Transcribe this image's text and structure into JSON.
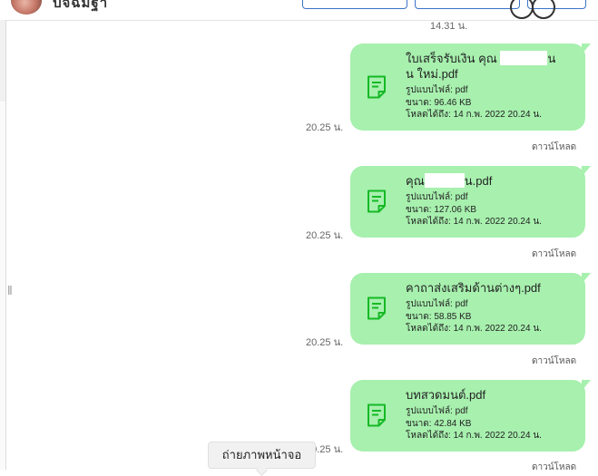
{
  "header": {
    "contact_name": "ปัจฉิมฐา"
  },
  "top_time": "14.31 น.",
  "messages": [
    {
      "time": "20.25 น.",
      "file_name_part1": "ใบเสร็จรับเงิน คุณ ",
      "file_name_part2": "น",
      "file_name_line2": "น ใหม่.pdf",
      "type": "รูปแบบไฟล์: pdf",
      "size": "ขนาด: 96.46 KB",
      "expires": "โหลดได้ถึง: 14 ก.พ. 2022 20.24 น.",
      "download": "ดาวน์โหลด"
    },
    {
      "time": "20.25 น.",
      "file_name_part1": "คุณ",
      "file_name_part2": "น.pdf",
      "type": "รูปแบบไฟล์: pdf",
      "size": "ขนาด: 127.06 KB",
      "expires": "โหลดได้ถึง: 14 ก.พ. 2022 20.24 น.",
      "download": "ดาวน์โหลด"
    },
    {
      "time": "20.25 น.",
      "file_name": "คาถาส่งเสริมด้านต่างๆ.pdf",
      "type": "รูปแบบไฟล์: pdf",
      "size": "ขนาด: 58.85 KB",
      "expires": "โหลดได้ถึง: 14 ก.พ. 2022 20.24 น.",
      "download": "ดาวน์โหลด"
    },
    {
      "time": "20.25 น.",
      "file_name": "บทสวดมนต์.pdf",
      "type": "รูปแบบไฟล์: pdf",
      "size": "ขนาด: 42.84 KB",
      "expires": "โหลดได้ถึง: 14 ก.พ. 2022 20.24 น.",
      "download": "ดาวน์โหลด"
    }
  ],
  "tooltip": {
    "screenshot": "ถ่ายภาพหน้าจอ"
  },
  "icons": {
    "file": "file-icon",
    "resize": "resize-handle-icon"
  },
  "colors": {
    "bubble": "#a7f0ae",
    "icon_green": "#16b925",
    "button_border": "#3b73c8"
  }
}
